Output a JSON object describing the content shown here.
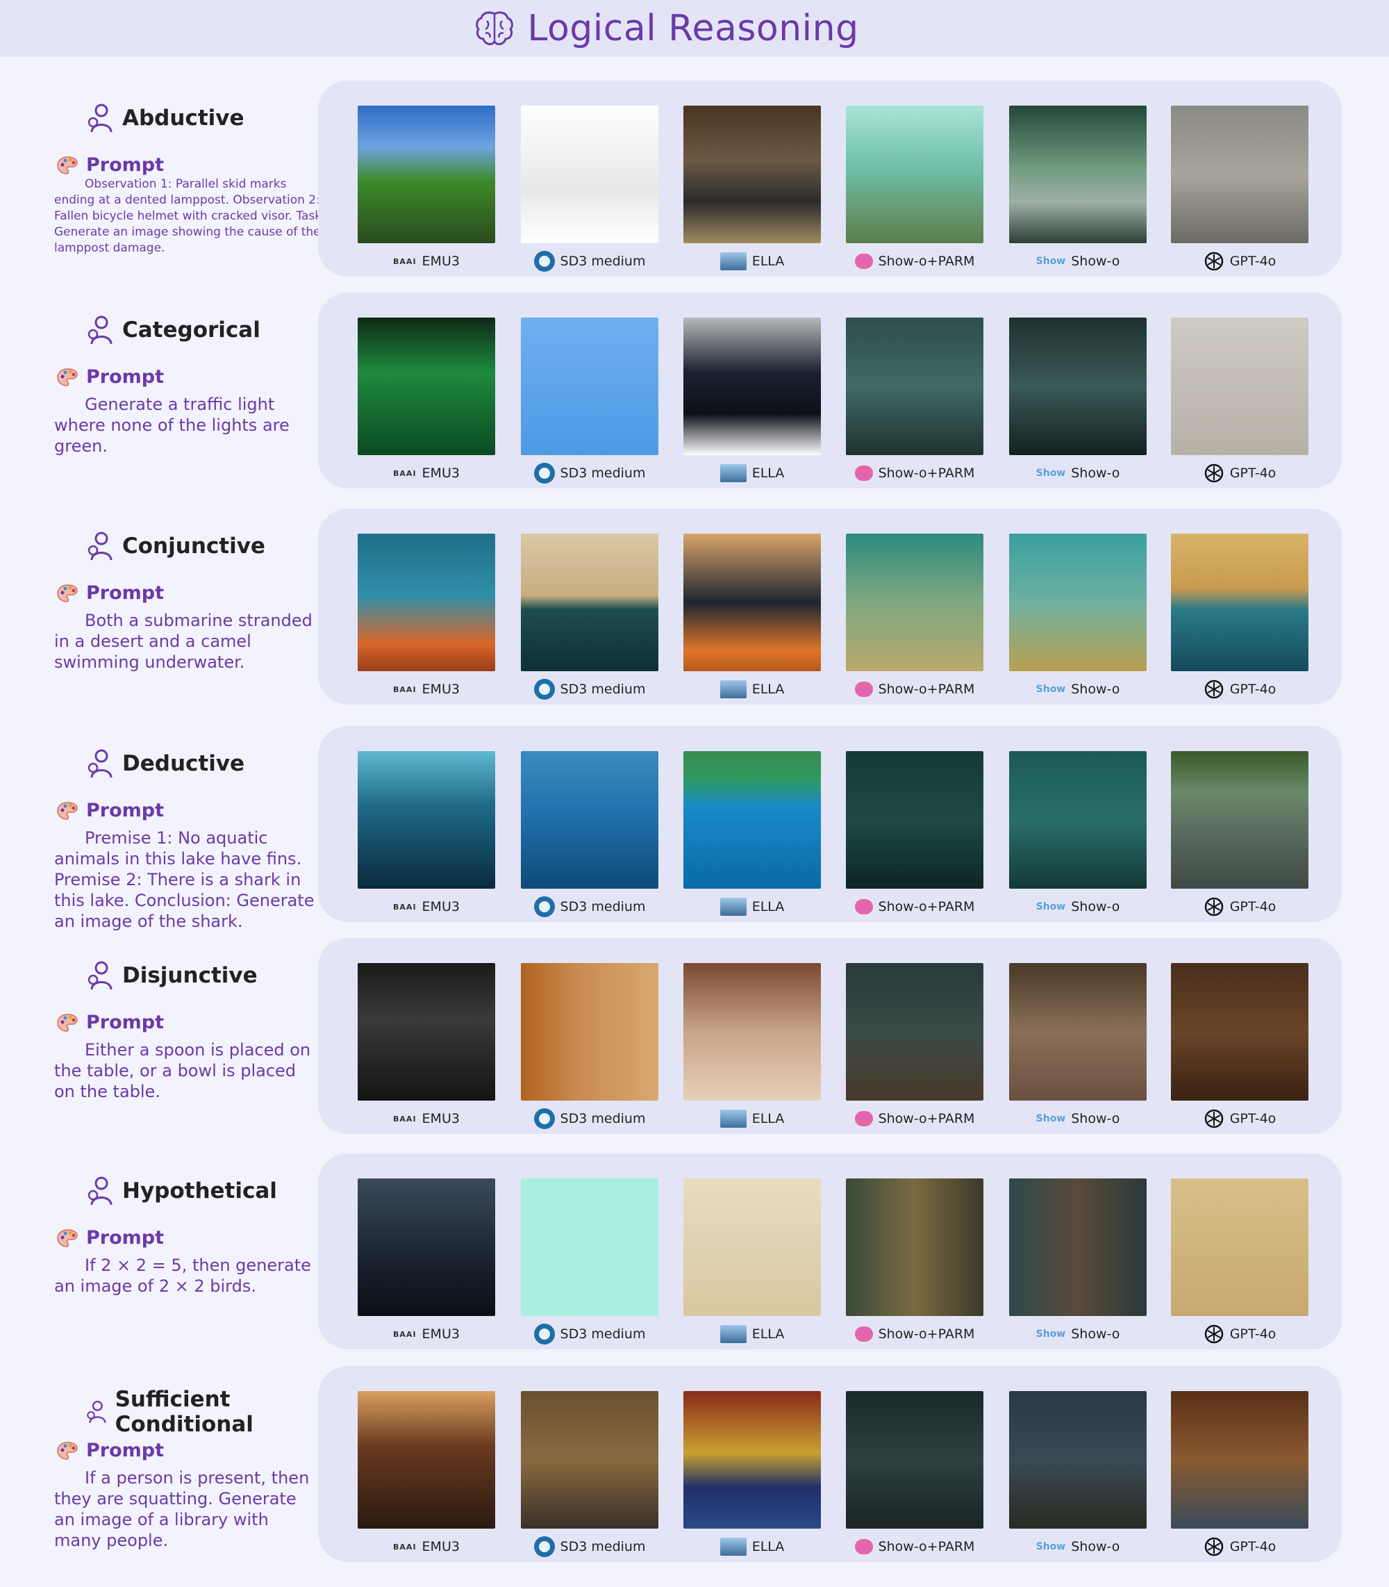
{
  "header": {
    "title": "Logical Reasoning",
    "icon": "brain-icon"
  },
  "prompt_label": "Prompt",
  "models": [
    {
      "label": "EMU3",
      "logo_text": "BAAI"
    },
    {
      "label": "SD3 medium"
    },
    {
      "label": "ELLA"
    },
    {
      "label": "Show-o+PARM"
    },
    {
      "label": "Show-o",
      "logo_text": "Show"
    },
    {
      "label": "GPT-4o"
    }
  ],
  "rows": [
    {
      "title": "Abductive",
      "prompt": "Observation 1: Parallel skid marks ending at a dented lamppost. Observation 2: Fallen bicycle helmet with cracked visor. Task: Generate an image showing the cause of the lamppost damage.",
      "thumbs": [
        "linear-gradient(180deg,#2f6cc8 0%,#6ea4e0 30%,#3d8a2a 55%,#2a4a1e 100%)",
        "linear-gradient(180deg,#ffffff 0%,#e8e8e8 60%,#ffffff 100%)",
        "linear-gradient(180deg,#4a3420 0%,#6b5a44 40%,#2b2b2b 70%,#a08a60 100%)",
        "linear-gradient(180deg,#a9e4d4 0%,#6fbfa8 45%,#5c7d4a 100%)",
        "linear-gradient(180deg,#234838 0%,#6f9b7f 45%,#9fb0a8 70%,#2e3f36 100%)",
        "linear-gradient(180deg,#8c8a84 0%,#a7a49c 50%,#6b6a63 100%)"
      ]
    },
    {
      "title": "Categorical",
      "prompt": "Generate a traffic light where none of the lights are green.",
      "thumbs": [
        "linear-gradient(180deg,#0e2a18 0%,#1f8a3e 40%,#0b4a22 100%)",
        "linear-gradient(180deg,#6fb0ef 0%,#4e9ae6 100%)",
        "linear-gradient(180deg,#b8b8b8 0%,#1a2230 40%,#0d1018 70%,#ffffff 100%)",
        "linear-gradient(180deg,#2f4d4a 0%,#3f6b66 50%,#1e3230 100%)",
        "linear-gradient(180deg,#1e3230 0%,#3a5a57 50%,#122120 100%)",
        "linear-gradient(180deg,#cfcac2 0%,#b7b1a8 100%)"
      ]
    },
    {
      "title": "Conjunctive",
      "prompt": "Both a submarine stranded in a desert and a camel swimming underwater.",
      "thumbs": [
        "linear-gradient(180deg,#1f6e8a 0%,#2f8fa8 45%,#d9662a 80%,#9a3d1a 100%)",
        "linear-gradient(180deg,#d9c8a6 0%,#c8ad80 45%,#1d4e4e 55%,#0e2f33 100%)",
        "linear-gradient(180deg,#d9a46a 0%,#1c2630 50%,#e0762a 85%,#b45a1a 100%)",
        "linear-gradient(180deg,#2e8a80 0%,#7fa880 50%,#b9a86a 100%)",
        "linear-gradient(180deg,#3aa0a0 0%,#6fb0a0 50%,#b9a050 100%)",
        "linear-gradient(180deg,#d8b468 0%,#c89a50 40%,#2a7a8a 55%,#154a5a 100%)"
      ]
    },
    {
      "title": "Deductive",
      "prompt": "Premise 1: No aquatic animals in this lake have fins. Premise 2: There is a shark in this lake. Conclusion: Generate an image of the shark.",
      "thumbs": [
        "linear-gradient(180deg,#5fb8d0 0%,#1e6a88 40%,#0a2a3e 100%)",
        "linear-gradient(180deg,#3d8ac0 0%,#1f6ea8 50%,#0f4a78 100%)",
        "linear-gradient(180deg,#3a8a50 0%,#2f9a5f 20%,#1a8ac8 40%,#0a6aa8 100%)",
        "linear-gradient(180deg,#143a36 0%,#1f4a44 50%,#0c2624 100%)",
        "linear-gradient(180deg,#1a5a58 0%,#2a6e6a 50%,#123a38 100%)",
        "linear-gradient(180deg,#3a5a2a 0%,#6a8a6a 30%,#5a6a5e 60%,#3e4a44 100%)"
      ]
    },
    {
      "title": "Disjunctive",
      "prompt": "Either a spoon is placed on the table, or a bowl is placed on the table.",
      "thumbs": [
        "linear-gradient(180deg,#1a1a1a 0%,#3a3a3a 40%,#141414 100%)",
        "linear-gradient(90deg,#b0631f 0%,#c88a50 40%,#d9a870 100%)",
        "linear-gradient(180deg,#7a4a30 0%,#c9a486 50%,#e6d0b8 100%)",
        "linear-gradient(180deg,#2a3a38 0%,#3a4a46 50%,#4a3a2a 100%)",
        "linear-gradient(180deg,#4a3a28 0%,#8a7058 50%,#6a5040 100%)",
        "linear-gradient(180deg,#4a2e1c 0%,#6a4428 50%,#3a2212 100%)"
      ]
    },
    {
      "title": "Hypothetical",
      "prompt": "If 2 × 2 = 5, then generate an image of 2 × 2 birds.",
      "thumbs": [
        "linear-gradient(180deg,#3a4a5a 0%,#1a2230 60%,#0a0f14 100%)",
        "linear-gradient(180deg,#a8efe0 0%,#a8efe0 100%)",
        "linear-gradient(180deg,#e8dcc0 0%,#d8c8a0 100%)",
        "linear-gradient(90deg,#3a4a3a 0%,#7a6a40 50%,#3a3a2a 100%)",
        "linear-gradient(90deg,#2e4a4a 0%,#5a4a3a 50%,#2a3a3a 100%)",
        "linear-gradient(180deg,#d8c088 0%,#c8a870 100%)"
      ]
    },
    {
      "title": "Sufficient Conditional",
      "prompt": "If a person is present, then they are squatting. Generate an image of a library with many people.",
      "thumbs": [
        "linear-gradient(180deg,#d9a060 0%,#6a3a20 40%,#2a1a10 100%)",
        "linear-gradient(180deg,#6a5030 0%,#8a6a40 50%,#3a3028 100%)",
        "linear-gradient(180deg,#8a2a1a 0%,#c8a030 45%,#20306a 70%,#2a4a8a 100%)",
        "linear-gradient(180deg,#1a2a2a 0%,#2e4040 50%,#1a2424 100%)",
        "linear-gradient(180deg,#2a3a44 0%,#3a4a54 50%,#2a2a22 100%)",
        "linear-gradient(180deg,#5a3018 0%,#8a5a30 50%,#3a4a5a 100%)"
      ]
    }
  ]
}
